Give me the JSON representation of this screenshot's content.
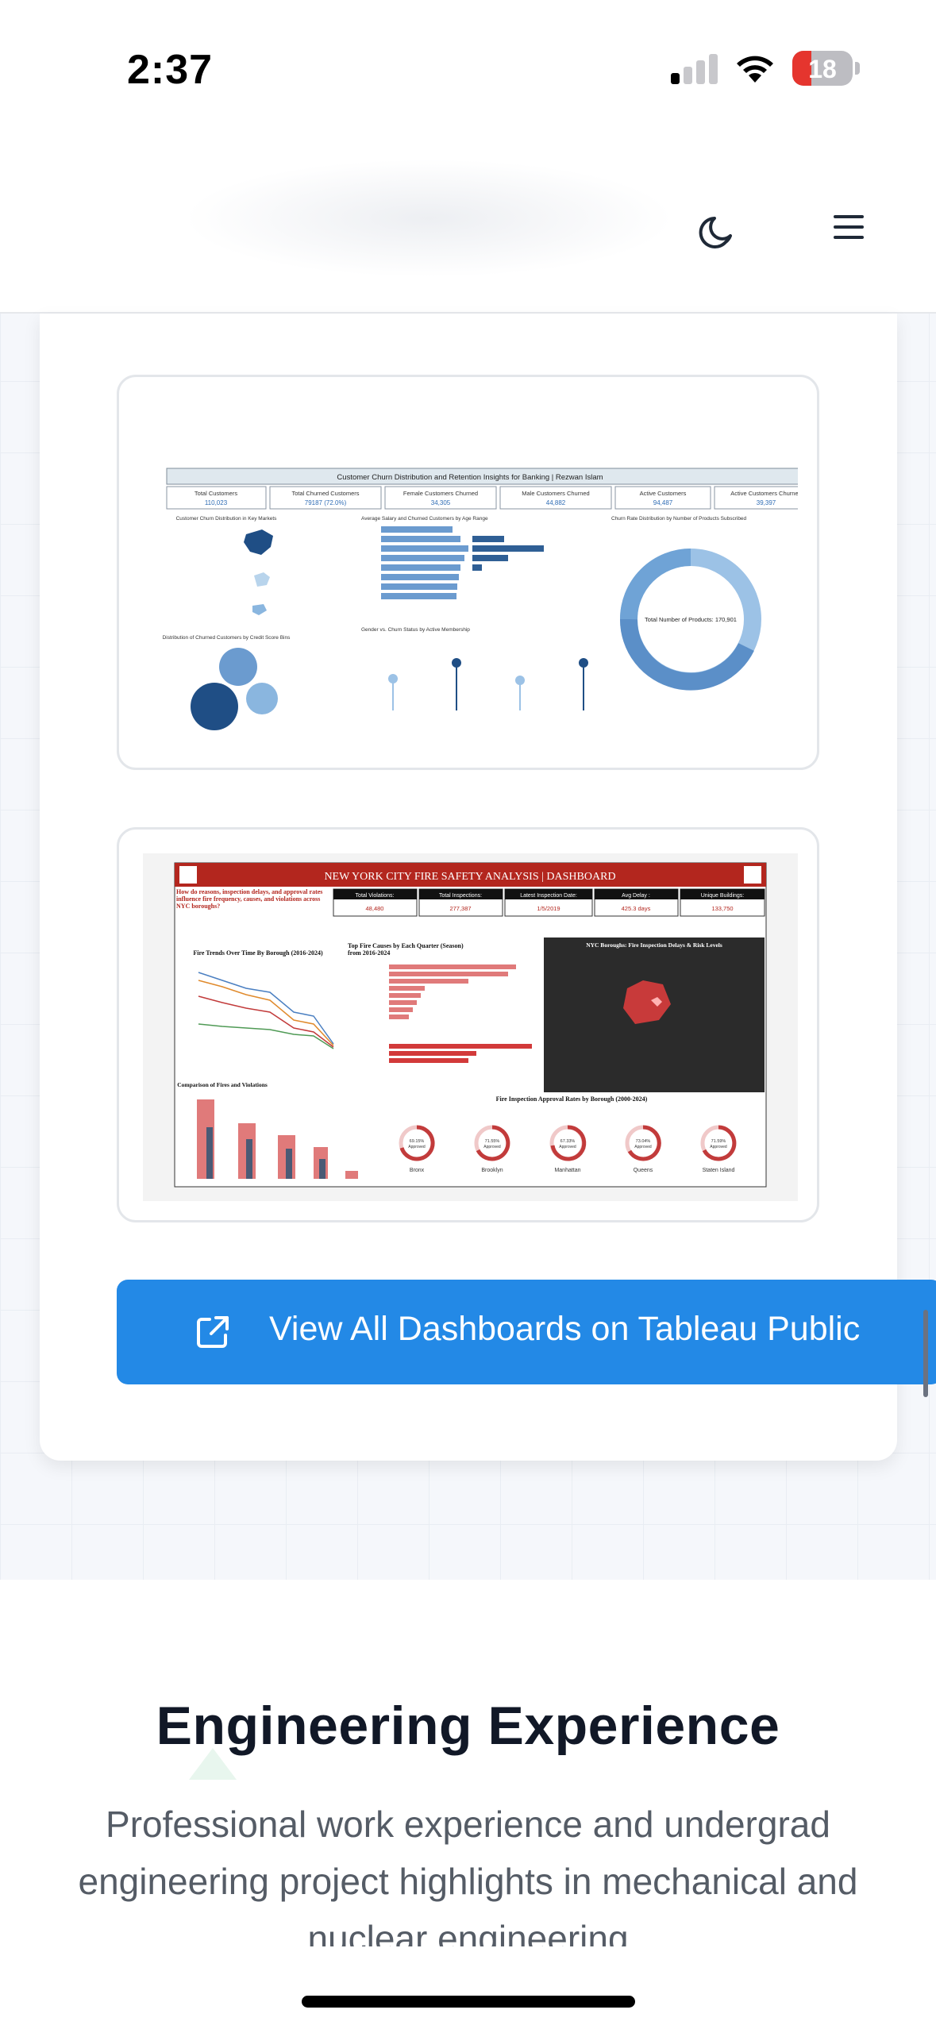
{
  "status_bar": {
    "time": "2:37",
    "battery": "18",
    "battery_color": "#e5352e"
  },
  "navbar": {
    "theme_icon": "moon-icon",
    "menu_icon": "hamburger-menu-icon"
  },
  "dashboards": [
    {
      "title": "Customer Churn Distribution and Retention Insights for Banking | Rezwan Islam",
      "kpis": [
        {
          "label": "Total Customers",
          "value": "110,023"
        },
        {
          "label": "Total Churned Customers",
          "value": "79187 (72.0%)"
        },
        {
          "label": "Female Customers Churned",
          "value": "34,305"
        },
        {
          "label": "Male Customers Churned",
          "value": "44,882"
        },
        {
          "label": "Active Customers",
          "value": "94,487"
        },
        {
          "label": "Active Customers Churned",
          "value": "39,397"
        }
      ],
      "panels": {
        "map": "Customer Churn Distribution in Key Markets",
        "bars": "Average Salary and Churned Customers by Age Range",
        "donut": "Churn Rate Distribution by Number of Products Subscribed",
        "bubbles": "Distribution of Churned Customers by Credit Score Bins",
        "lollipop": "Gender vs. Churn Status by Active Membership"
      },
      "donut_center": "Total Number of Products: 170,901"
    },
    {
      "title": "NEW YORK CITY FIRE SAFETY ANALYSIS | DASHBOARD",
      "question": "How do reasons, inspection delays, and approval rates influence fire frequency, causes, and violations across NYC boroughs?",
      "kpis": [
        {
          "label": "Total Violations:",
          "value": "48,480"
        },
        {
          "label": "Total Inspections:",
          "value": "277,387"
        },
        {
          "label": "Latest Inspection Date:",
          "value": "1/5/2019"
        },
        {
          "label": "Avg Delay :",
          "value": "425.3 days"
        },
        {
          "label": "Unique Buildings:",
          "value": "133,750"
        }
      ],
      "panels": {
        "trend": "Fire Trends Over Time By Borough (2016-2024)",
        "causes": "Top Fire Causes by Each Quarter (Season) from 2016-2024",
        "map": "NYC Boroughs: Fire Inspection Delays & Risk Levels",
        "compare": "Comparison of Fires and Violations",
        "approval": "Fire Inspection Approval Rates by Borough (2000-2024)"
      },
      "approvals": [
        {
          "pct": "69.15%",
          "borough": "Bronx"
        },
        {
          "pct": "71.55%",
          "borough": "Brooklyn"
        },
        {
          "pct": "67.33%",
          "borough": "Manhattan"
        },
        {
          "pct": "73.04%",
          "borough": "Queens"
        },
        {
          "pct": "71.59%",
          "borough": "Staten Island"
        }
      ],
      "approved_label": "Approved"
    }
  ],
  "cta": {
    "label": "View All Dashboards on Tableau Public",
    "icon": "external-link-icon",
    "color": "#2389e6"
  },
  "section": {
    "title": "Engineering Experience",
    "subtitle": "Professional work experience and undergrad engineering project highlights in mechanical and nuclear engineering"
  }
}
